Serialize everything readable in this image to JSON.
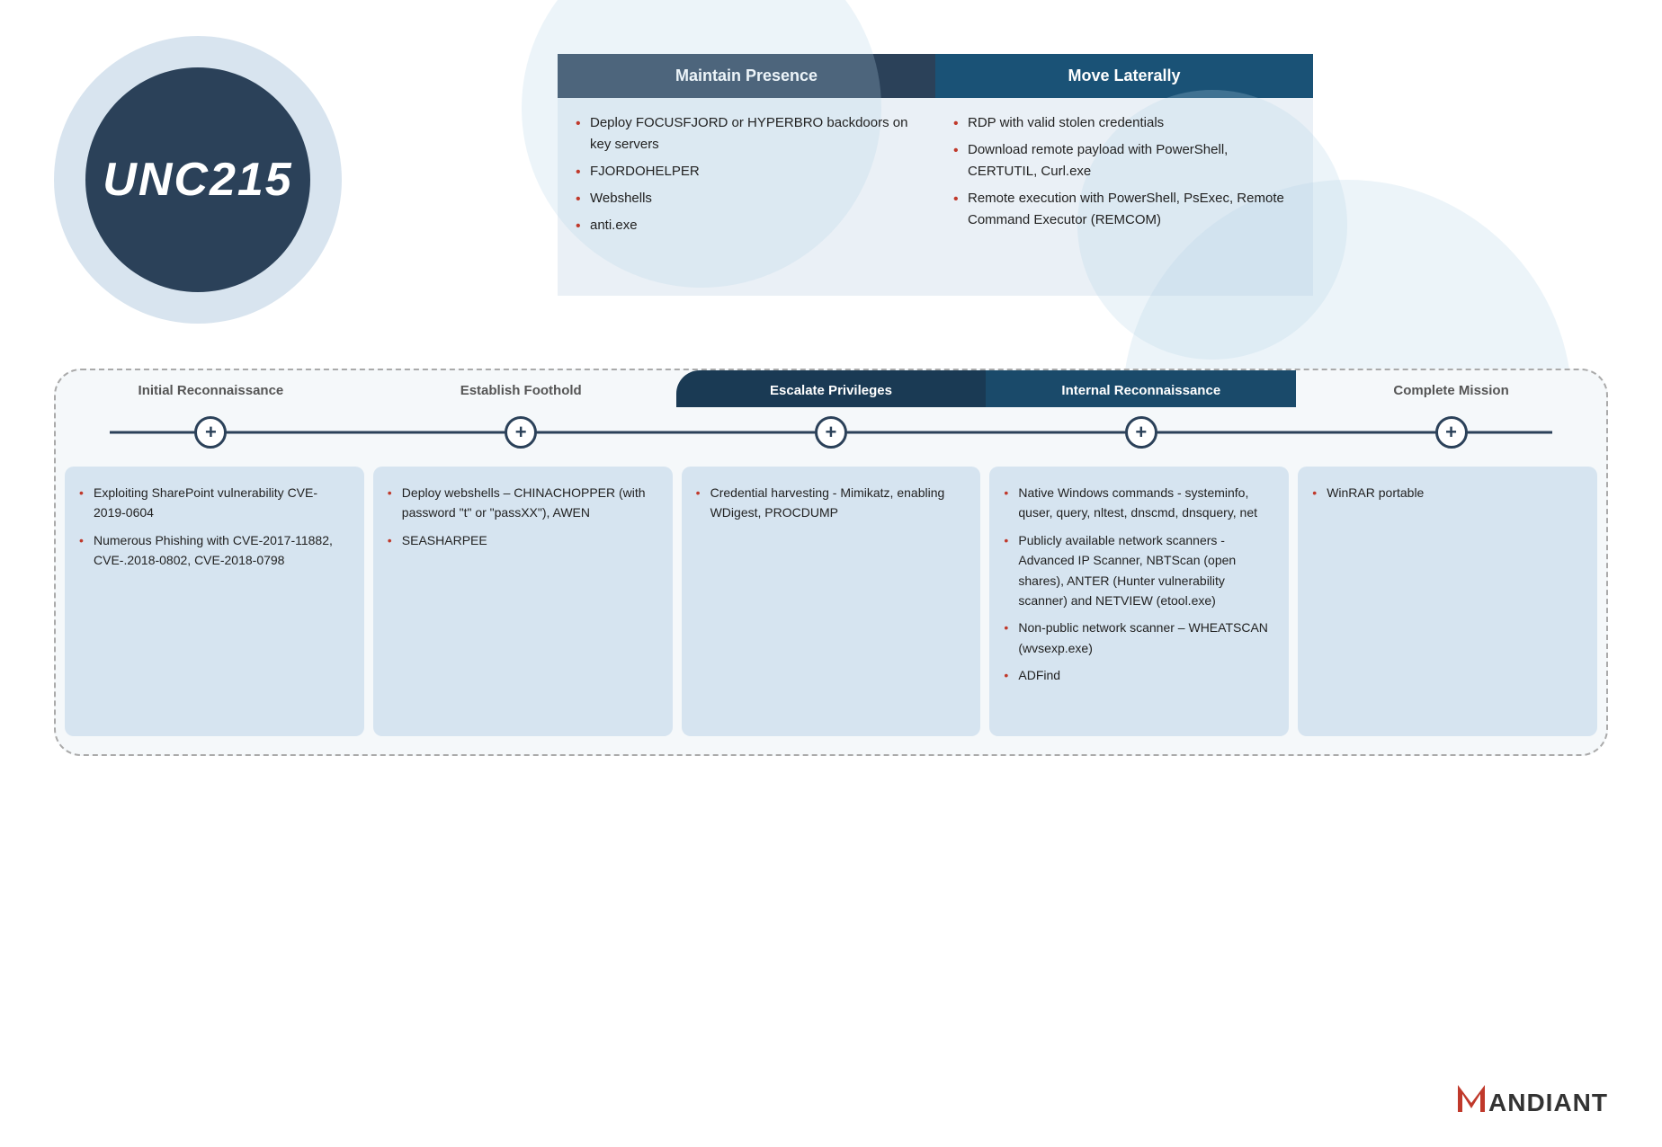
{
  "logo": {
    "text": "UNC215"
  },
  "top_boxes": [
    {
      "id": "maintain",
      "header": "Maintain Presence",
      "items": [
        "Deploy FOCUSFJORD or HYPERBRO backdoors on key servers",
        "FJORDOHELPER",
        "Webshells",
        "anti.exe"
      ]
    },
    {
      "id": "move",
      "header": "Move Laterally",
      "items": [
        "RDP with valid stolen credentials",
        "Download remote payload with PowerShell, CERTUTIL, Curl.exe",
        "Remote execution with PowerShell, PsExec, Remote Command Executor (REMCOM)"
      ]
    }
  ],
  "timeline": {
    "columns": [
      {
        "id": "initial-recon",
        "header": "Initial Reconnaissance",
        "dark": false,
        "items": [
          "Exploiting SharePoint vulnerability CVE-2019-0604",
          "Numerous Phishing with CVE-2017-11882, CVE-.2018-0802, CVE-2018-0798"
        ]
      },
      {
        "id": "establish-foothold",
        "header": "Establish Foothold",
        "dark": false,
        "items": [
          "Deploy webshells – CHINACHOPPER (with password \"t\" or \"passXX\"), AWEN",
          "SEASHARPEE"
        ]
      },
      {
        "id": "escalate-privileges",
        "header": "Escalate Privileges",
        "dark": true,
        "items": [
          "Credential harvesting - Mimikatz, enabling WDigest, PROCDUMP"
        ]
      },
      {
        "id": "internal-recon",
        "header": "Internal Reconnaissance",
        "dark": true,
        "items": [
          "Native Windows commands - systeminfo, quser, query, nltest, dnscmd, dnsquery, net",
          "Publicly available network scanners - Advanced IP Scanner, NBTScan (open shares), ANTER (Hunter vulnerability scanner) and NETVIEW (etool.exe)",
          "Non-public network scanner – WHEATSCAN (wvsexp.exe)",
          "ADFind"
        ]
      },
      {
        "id": "complete-mission",
        "header": "Complete Mission",
        "dark": false,
        "items": [
          "WinRAR portable"
        ]
      }
    ]
  },
  "mandiant": {
    "label": "ANDIANT"
  }
}
